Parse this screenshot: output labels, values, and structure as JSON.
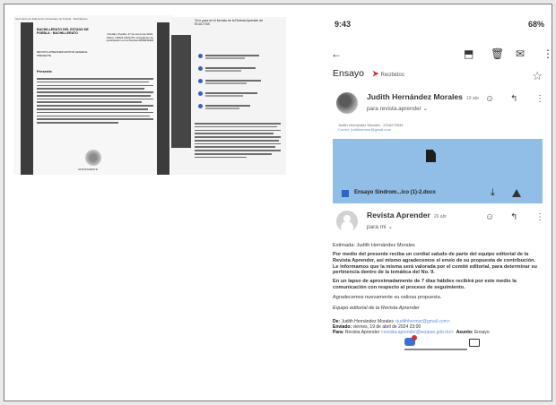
{
  "doc": {
    "top_line": "Secretaría de Educación del Estado de Puebla · Bachillerato",
    "institution": "BACHILLERATO DEL ESTADO DE PUEBLA · BACHILLERATO",
    "meta": "Ocotlán, Puebla, 17 de enero de 2024. Oficio: 1/2024 ASUNTO: Aceptación de participación en la Revista APRENDER",
    "addressee": "REVISTA APRENDER EDITOR GENERAL PRESENTE",
    "heading": "Presente",
    "signature_caption": "ATENTAMENTE"
  },
  "chat": {
    "header": "Te lo pase en el formato de la Revista Aprender de",
    "header2": "EDUCTIDE"
  },
  "phone": {
    "status_time": "9:43",
    "status_right": "68%",
    "subject": "Ensayo",
    "label": "Recibidos",
    "sender1": {
      "name": "Judith Hernández Morales",
      "time": "19 abr",
      "to": "para revista.aprender"
    },
    "sender1_meta": "Judith Hernández Morales · 2216279934",
    "sender1_email": "Correo: judithhermor@gmail.com",
    "attachment_name": "Ensayo Sindrom...ico (1)-2.docx",
    "sender2": {
      "name": "Revista Aprender",
      "time": "26 abr",
      "to": "para mí"
    },
    "greeting": "Estimada: Judith Hernández Morales",
    "para1": "Por medio del presente reciba un cordial saludo de parte del equipo editorial de la Revista Aprender, así mismo agradecemos el envío de su propuesta de contribución. Le informamos que la misma será valorada por el comité editorial, para determinar su pertinencia dentro de la temática del No. 9.",
    "para2": "En un lapso de aproximadamente de 7 días hábiles recibirá por este medio la comunicación con respecto al proceso de seguimiento.",
    "para3": "Agradecemos nuevamente su valiosa propuesta.",
    "signature": "Equipo editorial de la Revista Aprender",
    "from_label": "De:",
    "from_value": "Judith Hernández Morales",
    "from_email": "<judithhermor@gmail.com>",
    "sent_label": "Enviado:",
    "sent_value": "viernes, 19 de abril de 2024 23:00",
    "to_label": "Para:",
    "to_value": "Revista Aprender",
    "to_email": "<revista.aprender@seppue.gob.mx>",
    "subject_label": "Asunto:",
    "subject_value": "Ensayo"
  }
}
